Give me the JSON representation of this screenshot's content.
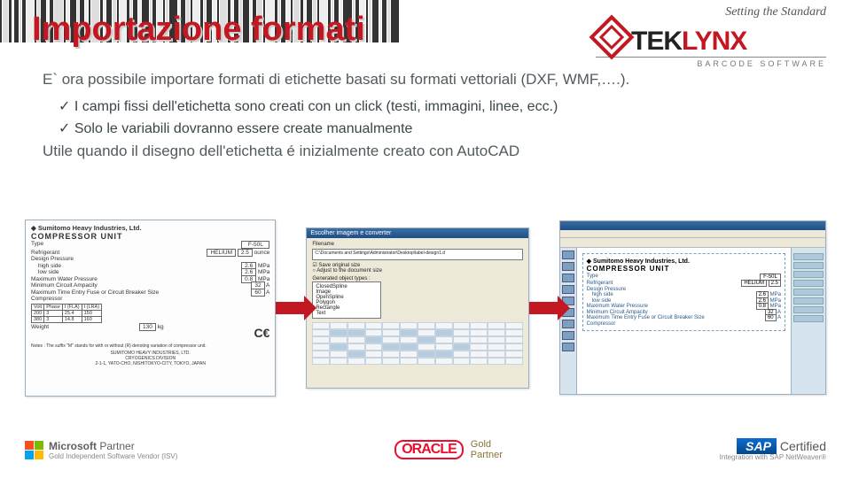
{
  "logo": {
    "tagline": "Setting the Standard",
    "brand_prefix": "TEK",
    "brand_suffix": "LYNX",
    "subtitle": "BARCODE SOFTWARE"
  },
  "title": "Importazione formati",
  "intro": "E` ora possibile importare formati di etichette basati su formati vettoriali (DXF, WMF,….).",
  "bullet1": "I campi fissi dell'etichetta sono creati con un click (testi, immagini, linee, ecc.)",
  "bullet2": "Solo le variabili dovranno essere create manualmente",
  "util": "Utile quando il disegno dell'etichetta é inizialmente creato con AutoCAD",
  "specsheet": {
    "company": "Sumitomo Heavy Industries, Ltd.",
    "title": "COMPRESSOR UNIT",
    "type_label": "Type",
    "type_value": "F-50L",
    "refrigerant_label": "Refrigerant",
    "refrigerant_value": "HELIUM",
    "refrigerant_qty": "2.5",
    "refrigerant_unit": "ounce",
    "design_pressure": "Design Pressure",
    "high_side": "high side",
    "high_val": "2.6",
    "low_side": "low side",
    "low_val": "2.6",
    "mpa": "MPa",
    "max_water": "Maximum Water Pressure",
    "max_water_val": "0.8",
    "min_circuit": "Minimum Circuit Ampacity",
    "min_circuit_val": "32",
    "amp": "A",
    "fuse": "Maximum Time Entry Fuse or Circuit Breaker Size",
    "fuse_val": "60",
    "compressor": "Compressor",
    "table_headers": [
      "Volt",
      "Phase",
      "I (FLA)",
      "I (LRA)"
    ],
    "table_row1": [
      "200",
      "3",
      "25.4",
      "150"
    ],
    "table_row2": [
      "380",
      "3",
      "14.8",
      "160"
    ],
    "weight_label": "Weight",
    "weight_val": "130",
    "weight_unit": "kg",
    "ce": "C€",
    "note": "Notes : The suffix \"M\" stands for with or without (R) denoting variation of compressor unit.",
    "addr1": "SUMITOMO HEAVY INDUSTRIES, LTD.",
    "addr2": "CRYOGENICS DIVISION",
    "addr3": "2-1-1, YATO-CHO, NISHITOKYO-CITY, TOKYO, JAPAN"
  },
  "dialog": {
    "title": "Escolher imagem e converter",
    "filename_label": "Filename",
    "filename_value": "C:\\Documents and Settings\\Administrator\\Desktop\\label-design1.d",
    "opt1": "Save original size",
    "opt2": "Adjust to the document size",
    "group": "Generated object types :",
    "types": [
      "ClosedSpline",
      "Image",
      "OpenSpline",
      "Polygon",
      "Rectangle",
      "Text"
    ]
  },
  "app": {
    "label_company": "Sumitomo Heavy Industries, Ltd.",
    "label_title": "COMPRESSOR UNIT",
    "rows": [
      {
        "k": "Type",
        "v": "F-50L"
      },
      {
        "k": "Refrigerant",
        "v": "HELIUM",
        "v2": "2.5"
      },
      {
        "k": "Design Pressure",
        "v": ""
      },
      {
        "k": "high side",
        "v": "2.6",
        "u": "MPa"
      },
      {
        "k": "low side",
        "v": "2.6",
        "u": "MPa"
      },
      {
        "k": "Maximum Water Pressure",
        "v": "0.8",
        "u": "MPa"
      },
      {
        "k": "Minimum Circuit Ampacity",
        "v": "32",
        "u": "A"
      },
      {
        "k": "Maximum Time Entry Fuse or Circuit Breaker Size",
        "v": "60",
        "u": "A"
      },
      {
        "k": "Compressor",
        "v": ""
      }
    ]
  },
  "footer": {
    "ms_partner": "Microsoft Partner",
    "ms_sub": "Gold Independent Software Vendor (ISV)",
    "oracle": "ORACLE",
    "oracle_gold": "Gold",
    "oracle_partner": "Partner",
    "sap_brand": "SAP",
    "sap_cert": " Certified",
    "sap_sub": "Integration with SAP NetWeaver®"
  }
}
